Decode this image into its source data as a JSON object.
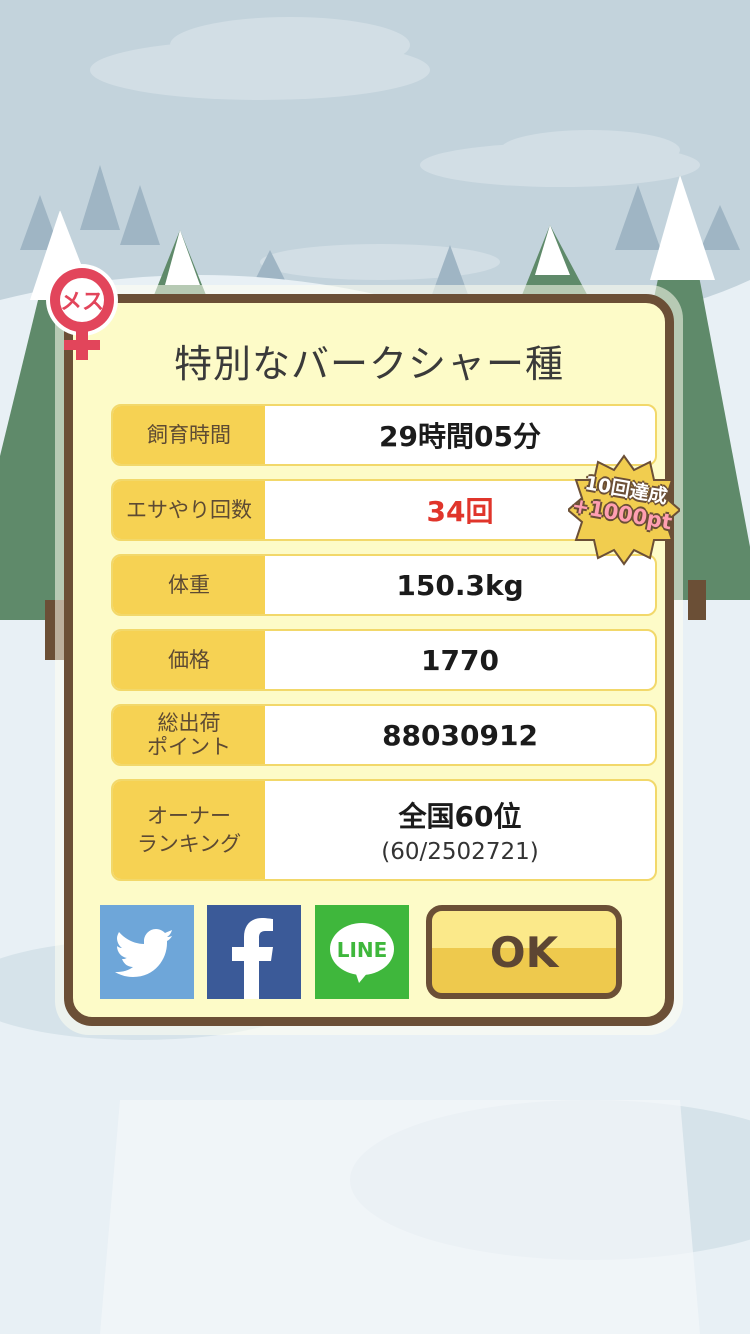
{
  "title": "特別なバークシャー種",
  "gender_badge": "メス",
  "rows": [
    {
      "label": "飼育時間",
      "value": "29時間05分"
    },
    {
      "label": "エサやり回数",
      "value": "34回"
    },
    {
      "label": "体重",
      "value": "150.3kg"
    },
    {
      "label": "価格",
      "value": "1770"
    },
    {
      "label": "総出荷\nポイント",
      "value": "88030912"
    },
    {
      "label": "オーナー\nランキング",
      "value": "全国60位",
      "sub": "(60/2502721)"
    }
  ],
  "achievement_badge": {
    "line1": "10回達成",
    "line2": "+1000pt"
  },
  "share": {
    "twitter_icon": "twitter-bird-icon",
    "facebook_icon": "facebook-f-icon",
    "line_label": "LINE"
  },
  "ok_label": "OK",
  "colors": {
    "twitter": "#6ea6d9",
    "facebook": "#3b5a98",
    "line": "#3fb73c",
    "value_red": "#e0352b",
    "label_bg": "#f6d253",
    "frame": "#6b4f36",
    "panel_bg": "#fdfbc8"
  }
}
